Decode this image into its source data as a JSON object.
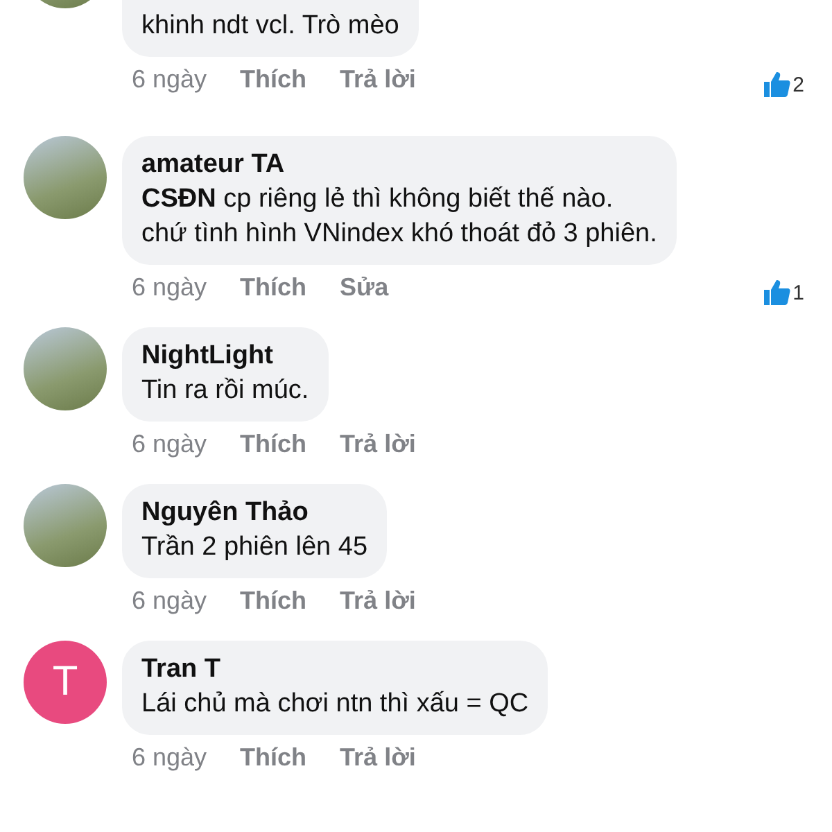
{
  "comments": [
    {
      "avatar": {
        "kind": "photo"
      },
      "lines": [
        "khinh ndt vcl. Trò mèo"
      ],
      "time": "6 ngày",
      "actions": [
        "Thích",
        "Trả lời"
      ],
      "likes": "2"
    },
    {
      "avatar": {
        "kind": "photo"
      },
      "author": "amateur TA",
      "lines": [
        "**CSĐN**  cp riêng lẻ thì không biết thế nào.",
        "chứ tình hình VNindex khó thoát đỏ 3 phiên."
      ],
      "time": "6 ngày",
      "actions": [
        "Thích",
        "Sửa"
      ],
      "likes": "1"
    },
    {
      "avatar": {
        "kind": "photo"
      },
      "author": "NightLight",
      "lines": [
        "Tin ra rồi múc."
      ],
      "time": "6 ngày",
      "actions": [
        "Thích",
        "Trả lời"
      ]
    },
    {
      "avatar": {
        "kind": "photo"
      },
      "author": "Nguyên Thảo",
      "lines": [
        "Trần 2 phiên lên 45"
      ],
      "time": "6 ngày",
      "actions": [
        "Thích",
        "Trả lời"
      ]
    },
    {
      "avatar": {
        "kind": "letter",
        "letter": "T",
        "color": "#e84a7f"
      },
      "author": "Tran T",
      "lines": [
        "Lái chủ mà chơi ntn thì xấu = QC"
      ],
      "time": "6 ngày",
      "actions": [
        "Thích",
        "Trả lời"
      ]
    }
  ]
}
